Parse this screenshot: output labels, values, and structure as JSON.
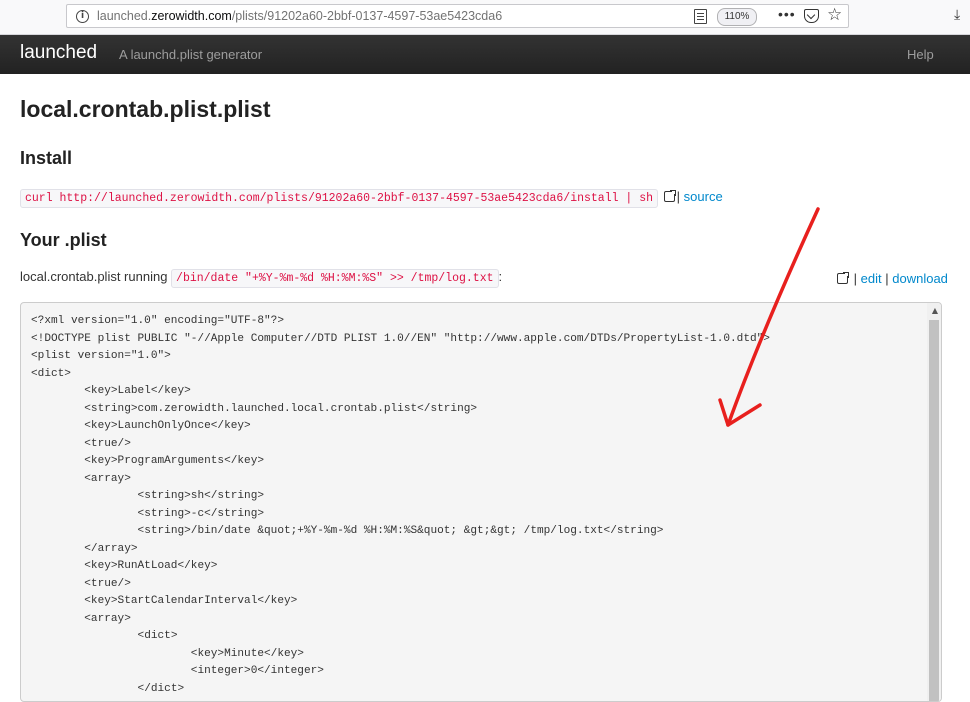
{
  "browser": {
    "url_prefix": "launched.",
    "url_domain": "zerowidth.com",
    "url_path": "/plists/91202a60-2bbf-0137-4597-53ae5423cda6",
    "zoom": "110%",
    "more_label": "•••"
  },
  "nav": {
    "brand": "launched",
    "tagline": "A launchd.plist generator",
    "help": "Help"
  },
  "page": {
    "title": "local.crontab.plist.plist",
    "install_heading": "Install",
    "install_command": "curl http://launched.zerowidth.com/plists/91202a60-2bbf-0137-4597-53ae5423cda6/install | sh",
    "source_link": "source",
    "separator": "|",
    "plist_heading": "Your .plist",
    "running_label": "local.crontab.plist running",
    "running_command": "/bin/date \"+%Y-%m-%d %H:%M:%S\" >> /tmp/log.txt",
    "after_command": ":",
    "edit_link": "edit",
    "download_link": "download"
  },
  "plist_lines": [
    "<?xml version=\"1.0\" encoding=\"UTF-8\"?>",
    "<!DOCTYPE plist PUBLIC \"-//Apple Computer//DTD PLIST 1.0//EN\" \"http://www.apple.com/DTDs/PropertyList-1.0.dtd\">",
    "<plist version=\"1.0\">",
    "<dict>",
    "\t<key>Label</key>",
    "\t<string>com.zerowidth.launched.local.crontab.plist</string>",
    "\t<key>LaunchOnlyOnce</key>",
    "\t<true/>",
    "\t<key>ProgramArguments</key>",
    "\t<array>",
    "\t\t<string>sh</string>",
    "\t\t<string>-c</string>",
    "\t\t<string>/bin/date &quot;+%Y-%m-%d %H:%M:%S&quot; &gt;&gt; /tmp/log.txt</string>",
    "\t</array>",
    "\t<key>RunAtLoad</key>",
    "\t<true/>",
    "\t<key>StartCalendarInterval</key>",
    "\t<array>",
    "\t\t<dict>",
    "\t\t\t<key>Minute</key>",
    "\t\t\t<integer>0</integer>",
    "\t\t</dict>"
  ],
  "annotation_color": "#e8201e"
}
